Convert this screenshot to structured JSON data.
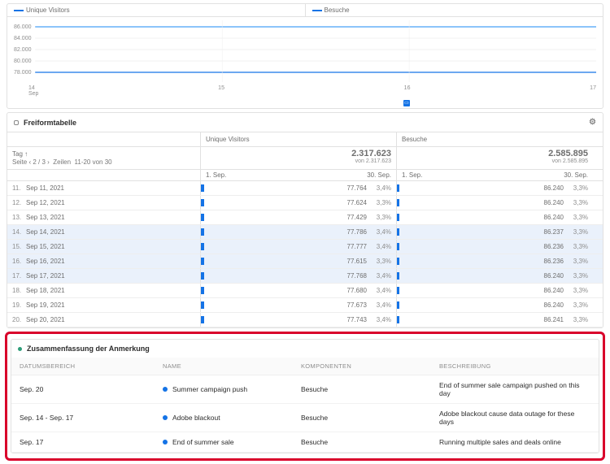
{
  "chartPanel": {
    "legend1": "Unique Visitors",
    "legend2": "Besuche",
    "yTicks": [
      "86.000",
      "84.000",
      "82.000",
      "80.000",
      "78.000"
    ],
    "xTicks": [
      "14\nSep",
      "15",
      "16",
      "17"
    ]
  },
  "tablePanel": {
    "title": "Freiformtabelle",
    "dimLabel": "Tag",
    "paginator": "Seite   2 / 3   •   Zeilen   11-20 von 30",
    "metrics": {
      "m1": {
        "label": "Unique Visitors",
        "total": "2.317.623",
        "sub": "von 2.317.623"
      },
      "m2": {
        "label": "Besuche",
        "total": "2.585.895",
        "sub": "von 2.585.895"
      }
    },
    "sparkHeader": {
      "from": "1. Sep.",
      "to": "30. Sep."
    },
    "rows": [
      {
        "n": "11.",
        "date": "Sep 11, 2021",
        "v1": "77.764",
        "p1": "3,4%",
        "v2": "86.240",
        "p2": "3,3%",
        "hl": false
      },
      {
        "n": "12.",
        "date": "Sep 12, 2021",
        "v1": "77.624",
        "p1": "3,3%",
        "v2": "86.240",
        "p2": "3,3%",
        "hl": false
      },
      {
        "n": "13.",
        "date": "Sep 13, 2021",
        "v1": "77.429",
        "p1": "3,3%",
        "v2": "86.240",
        "p2": "3,3%",
        "hl": false
      },
      {
        "n": "14.",
        "date": "Sep 14, 2021",
        "v1": "77.786",
        "p1": "3,4%",
        "v2": "86.237",
        "p2": "3,3%",
        "hl": true
      },
      {
        "n": "15.",
        "date": "Sep 15, 2021",
        "v1": "77.777",
        "p1": "3,4%",
        "v2": "86.236",
        "p2": "3,3%",
        "hl": true
      },
      {
        "n": "16.",
        "date": "Sep 16, 2021",
        "v1": "77.615",
        "p1": "3,3%",
        "v2": "86.236",
        "p2": "3,3%",
        "hl": true
      },
      {
        "n": "17.",
        "date": "Sep 17, 2021",
        "v1": "77.768",
        "p1": "3,4%",
        "v2": "86.240",
        "p2": "3,3%",
        "hl": true
      },
      {
        "n": "18.",
        "date": "Sep 18, 2021",
        "v1": "77.680",
        "p1": "3,4%",
        "v2": "86.240",
        "p2": "3,3%",
        "hl": false
      },
      {
        "n": "19.",
        "date": "Sep 19, 2021",
        "v1": "77.673",
        "p1": "3,4%",
        "v2": "86.240",
        "p2": "3,3%",
        "hl": false
      },
      {
        "n": "20.",
        "date": "Sep 20, 2021",
        "v1": "77.743",
        "p1": "3,4%",
        "v2": "86.241",
        "p2": "3,3%",
        "hl": false
      }
    ]
  },
  "annPanel": {
    "title": "Zusammenfassung der Anmerkung",
    "headers": {
      "c1": "Datumsbereich",
      "c2": "Name",
      "c3": "Komponenten",
      "c4": "Beschreibung"
    },
    "rows": [
      {
        "range": "Sep. 20",
        "name": "Summer campaign push",
        "comp": "Besuche",
        "desc": "End of summer sale campaign pushed on this day"
      },
      {
        "range": "Sep. 14 - Sep. 17",
        "name": "Adobe blackout",
        "comp": "Besuche",
        "desc": "Adobe blackout cause data outage for these days"
      },
      {
        "range": "Sep. 17",
        "name": "End of summer sale",
        "comp": "Besuche",
        "desc": "Running multiple sales and deals online"
      }
    ]
  },
  "chart_data": {
    "type": "line",
    "x": [
      14,
      15,
      16,
      17
    ],
    "xlabel": "Sep",
    "ylim": [
      78000,
      86000
    ],
    "series": [
      {
        "name": "Unique Visitors",
        "values": [
          78000,
          78000,
          78000,
          78000
        ]
      },
      {
        "name": "Besuche",
        "values": [
          86000,
          86000,
          86000,
          86000
        ]
      }
    ],
    "annotations_at_x": [
      16
    ]
  }
}
